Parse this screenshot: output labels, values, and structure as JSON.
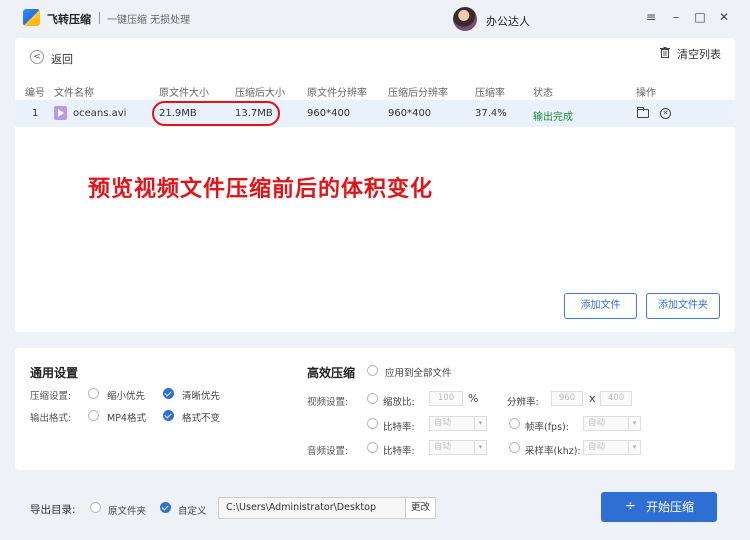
{
  "titlebar": {
    "app_name": "飞转压缩",
    "slogan": "一键压缩 无损处理",
    "username": "办公达人",
    "menu_icon": "≡",
    "minimize_icon": "–",
    "maximize_icon": "□",
    "close_icon": "✕"
  },
  "toolbar": {
    "back_icon": "<",
    "back_label": "返回",
    "clear_label": "清空列表"
  },
  "table": {
    "headers": [
      "编号",
      "文件名称",
      "原文件大小",
      "压缩后大小",
      "原文件分辨率",
      "压缩后分辨率",
      "压缩率",
      "状态",
      "操作"
    ],
    "rows": [
      {
        "index": "1",
        "name": "oceans.avi",
        "original_size": "21.9MB",
        "compressed_size": "13.7MB",
        "original_res": "960*400",
        "compressed_res": "960*400",
        "ratio": "37.4%",
        "status": "输出完成"
      }
    ]
  },
  "annotation": "预览视频文件压缩前后的体积变化",
  "buttons": {
    "add_file": "添加文件",
    "add_folder": "添加文件夹",
    "change": "更改",
    "start": "开始压缩",
    "start_icon": "÷"
  },
  "general_settings": {
    "title": "通用设置",
    "compress_label": "压缩设置:",
    "compress_options": [
      "缩小优先",
      "清晰优先"
    ],
    "compress_selected": "清晰优先",
    "format_label": "输出格式:",
    "format_options": [
      "MP4格式",
      "格式不变"
    ],
    "format_selected": "格式不变"
  },
  "advanced": {
    "title": "高效压缩",
    "apply_all": "应用到全部文件",
    "video_label": "视频设置:",
    "scale_label": "缩放比:",
    "scale_value": "100",
    "scale_unit": "%",
    "resolution_label": "分辨率:",
    "res_w": "960",
    "res_x": "x",
    "res_h": "400",
    "bitrate_label": "比特率:",
    "framerate_label": "帧率(fps):",
    "audio_label": "音频设置:",
    "audio_bitrate_label": "比特率:",
    "samplerate_label": "采样率(khz):",
    "auto": "自动",
    "dropdown_arrow": "▾"
  },
  "output": {
    "label": "导出目录:",
    "options": [
      "原文件夹",
      "自定义"
    ],
    "selected": "自定义",
    "path": "C:\\Users\\Administrator\\Desktop"
  },
  "colors": {
    "accent": "#2f6fd3",
    "highlight": "#e1141a",
    "success": "#1a8f2e"
  }
}
